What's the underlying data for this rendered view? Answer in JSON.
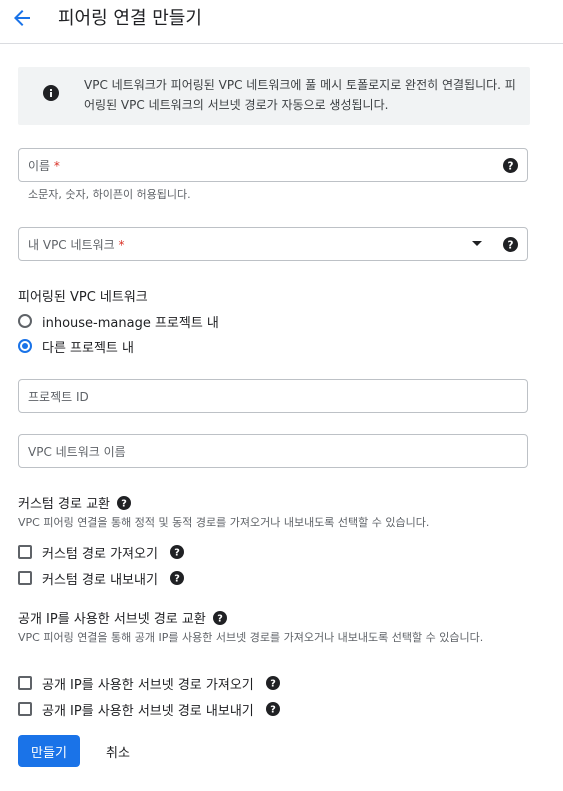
{
  "header": {
    "title": "피어링 연결 만들기"
  },
  "info": {
    "text": "VPC 네트워크가 피어링된 VPC 네트워크에 풀 메시 토폴로지로 완전히 연결됩니다. 피어링된 VPC 네트워크의 서브넷 경로가 자동으로 생성됩니다."
  },
  "name_field": {
    "label": "이름",
    "required": "*",
    "hint": "소문자, 숫자, 하이픈이 허용됩니다."
  },
  "vpc_field": {
    "label": "내 VPC 네트워크",
    "required": "*"
  },
  "peered": {
    "title": "피어링된 VPC 네트워크",
    "option1": "inhouse-manage 프로젝트 내",
    "option2": "다른 프로젝트 내",
    "selected": "다른 프로젝트 내"
  },
  "project_id_field": {
    "placeholder": "프로젝트 ID"
  },
  "vpc_name_field": {
    "placeholder": "VPC 네트워크 이름"
  },
  "custom_routes": {
    "title": "커스텀 경로 교환",
    "desc": "VPC 피어링 연결을 통해 정적 및 동적 경로를 가져오거나 내보내도록 선택할 수 있습니다.",
    "import_label": "커스텀 경로 가져오기",
    "export_label": "커스텀 경로 내보내기"
  },
  "public_ip_routes": {
    "title": "공개 IP를 사용한 서브넷 경로 교환",
    "desc": "VPC 피어링 연결을 통해 공개 IP를 사용한 서브넷 경로를 가져오거나 내보내도록 선택할 수 있습니다.",
    "import_label": "공개 IP를 사용한 서브넷 경로 가져오기",
    "export_label": "공개 IP를 사용한 서브넷 경로 내보내기"
  },
  "actions": {
    "create": "만들기",
    "cancel": "취소"
  },
  "colors": {
    "accent": "#1a73e8",
    "required": "#d93025",
    "info_bg": "#f1f3f4"
  }
}
